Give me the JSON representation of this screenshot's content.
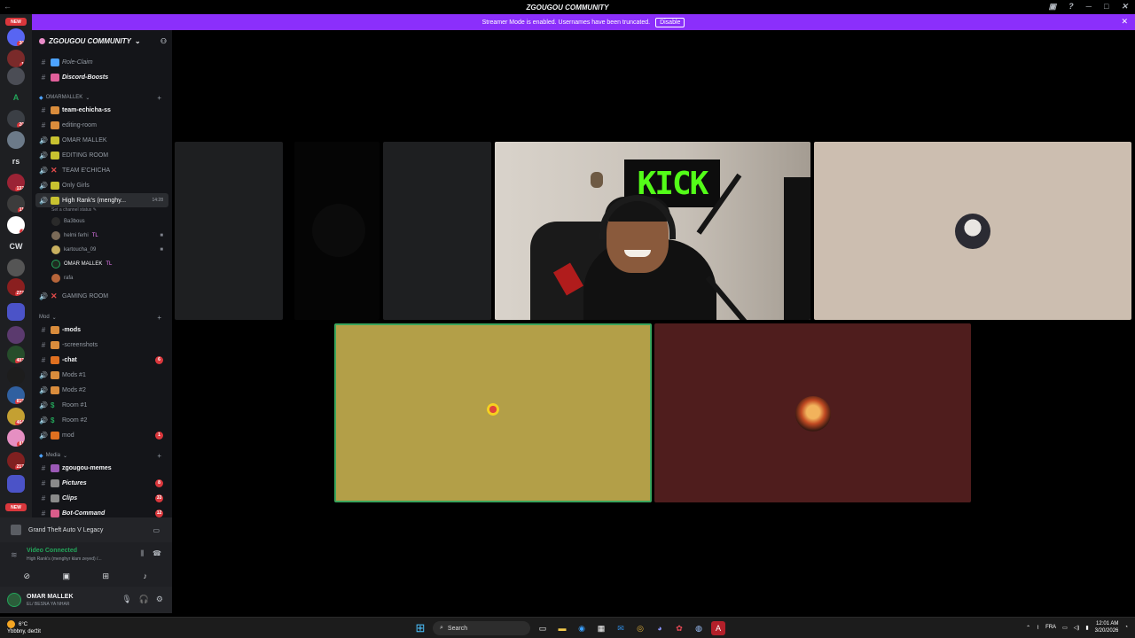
{
  "window": {
    "title": "ZGOUGOU COMMUNITY"
  },
  "banner": {
    "text": "Streamer Mode is enabled. Usernames have been truncated.",
    "button": "Disable"
  },
  "rail": {
    "new_top": "NEW",
    "new_bottom": "NEW",
    "text_servers": [
      "A",
      "rs",
      "CW"
    ],
    "badges": [
      "30",
      "1",
      "20",
      "132",
      "11",
      "7",
      "272",
      "402",
      "819",
      "464",
      "81",
      "217"
    ]
  },
  "guild": {
    "name": "ZGOUGOU COMMUNITY"
  },
  "channels": {
    "top": [
      {
        "name": "Role-Claim",
        "style": "italic"
      },
      {
        "name": "Discord-Boosts",
        "style": "bold-italic"
      }
    ],
    "cat1": "OMARMALLEK",
    "cat1_items": [
      {
        "name": "team-echicha-ss",
        "bold": true
      },
      {
        "name": "editing-room"
      },
      {
        "name": "OMAR MALLEK"
      },
      {
        "name": "EDITING ROOM"
      },
      {
        "name": "TEAM E'CHICHA"
      },
      {
        "name": "Only Girls"
      },
      {
        "name": "High Rank's (menghy...",
        "time": "14:28"
      }
    ],
    "channel_status": "Set a channel status",
    "voice_users": [
      {
        "name": "Ba3bous"
      },
      {
        "name": "helmi ferhi",
        "tag": "TL"
      },
      {
        "name": "kartoucha_09"
      },
      {
        "name": "OMAR MALLEK",
        "tag": "TL"
      },
      {
        "name": "rafa"
      }
    ],
    "gaming_room": "GAMING ROOM",
    "cat2": "Mod",
    "cat2_items": [
      {
        "name": "-mods",
        "bold": true
      },
      {
        "name": "-screenshots"
      },
      {
        "name": "-chat",
        "bold": true,
        "count": "6"
      },
      {
        "name": "Mods #1"
      },
      {
        "name": "Mods #2"
      },
      {
        "name": "Room #1"
      },
      {
        "name": "Room #2"
      },
      {
        "name": "mod",
        "count": "1"
      }
    ],
    "cat3": "Media",
    "cat3_items": [
      {
        "name": "zgougou-memes",
        "bold": true
      },
      {
        "name": "Pictures",
        "bold": true,
        "count": "8"
      },
      {
        "name": "Clips",
        "bold": true,
        "count": "33"
      },
      {
        "name": "Bot-Command",
        "bold": true,
        "count": "12"
      }
    ]
  },
  "activity": {
    "game": "Grand Theft Auto V Legacy"
  },
  "voice": {
    "status": "Video Connected",
    "channel": "High Rank's (menghyr klam zeyed) /..."
  },
  "user": {
    "name": "OMAR MALLEK",
    "status": "EL/ BESNA YA NHAR"
  },
  "stage": {
    "cam_sign": "KICK"
  },
  "taskbar": {
    "temp": "6°C",
    "weather": "Ybbbny, deržit",
    "search": "Search",
    "lang": "FRA",
    "time": "12:01 AM",
    "date": "3/20/2026"
  },
  "colors": {
    "accent": "#8b2ffb",
    "online": "#23a55a",
    "mention": "#da373c",
    "kick": "#53fc18"
  }
}
